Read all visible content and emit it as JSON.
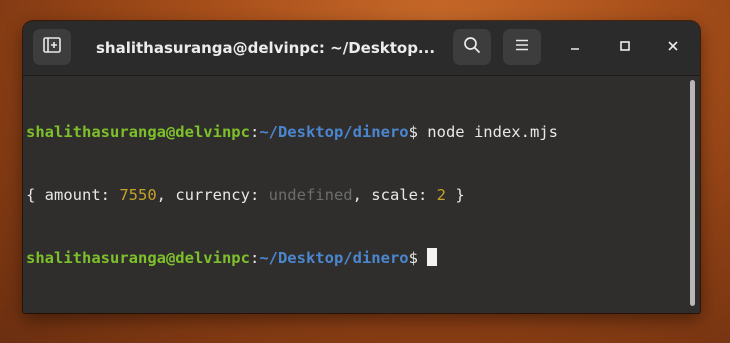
{
  "window": {
    "title": "shalithasuranga@delvinpc: ~/Desktop..."
  },
  "titlebar": {
    "icons": [
      "new-tab-icon",
      "search-icon",
      "hamburger-menu-icon",
      "minimize-icon",
      "maximize-icon",
      "close-icon"
    ]
  },
  "terminal": {
    "line1": {
      "user": "shalithasuranga@delvinpc",
      "colon": ":",
      "path": "~/Desktop/dinero",
      "prompt": "$",
      "command": " node index.mjs"
    },
    "line2": {
      "open": "{ amount: ",
      "amount": "7550",
      "mid1": ", currency: ",
      "currency": "undefined",
      "mid2": ", scale: ",
      "scale": "2",
      "close": " }"
    },
    "line3": {
      "user": "shalithasuranga@delvinpc",
      "colon": ":",
      "path": "~/Desktop/dinero",
      "prompt": "$"
    }
  },
  "colors": {
    "user": "#7ec02b",
    "path": "#4b86d0",
    "number": "#c5a22a",
    "undefined": "#6d6d6d",
    "terminal_bg": "#2f2e2c",
    "titlebar_bg": "#2b2b2b"
  }
}
